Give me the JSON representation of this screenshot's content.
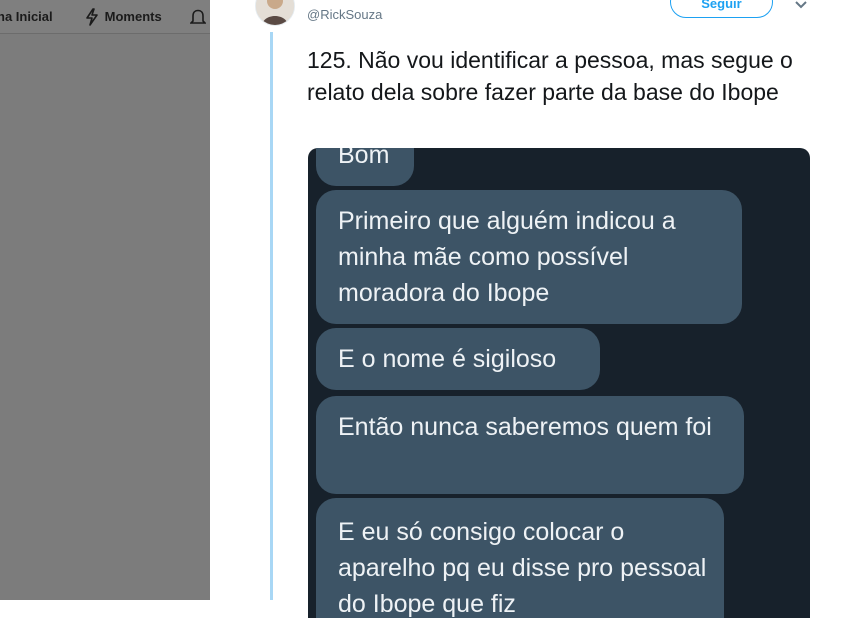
{
  "nav": {
    "home_label": "na Inicial",
    "moments_label": "Moments",
    "notifications_icon": "bell-icon"
  },
  "tweet": {
    "handle": "@RickSouza",
    "follow_label": "Seguir",
    "text": "125. Não vou identificar a pessoa, mas segue o relato dela sobre fazer parte da base do Ibope"
  },
  "chat": {
    "messages": [
      "Bom",
      "Primeiro que alguém indicou a minha mãe como possível moradora do Ibope",
      "E o nome é sigiloso",
      "Então nunca saberemos quem foi",
      "E eu só consigo colocar o aparelho pq eu disse pro pessoal do Ibope que fiz"
    ]
  },
  "colors": {
    "accent": "#1da1f2",
    "thread_line": "#a8d7f5",
    "chat_background": "#17212b",
    "bubble": "#3d5466",
    "backdrop": "#7c7c7c"
  }
}
